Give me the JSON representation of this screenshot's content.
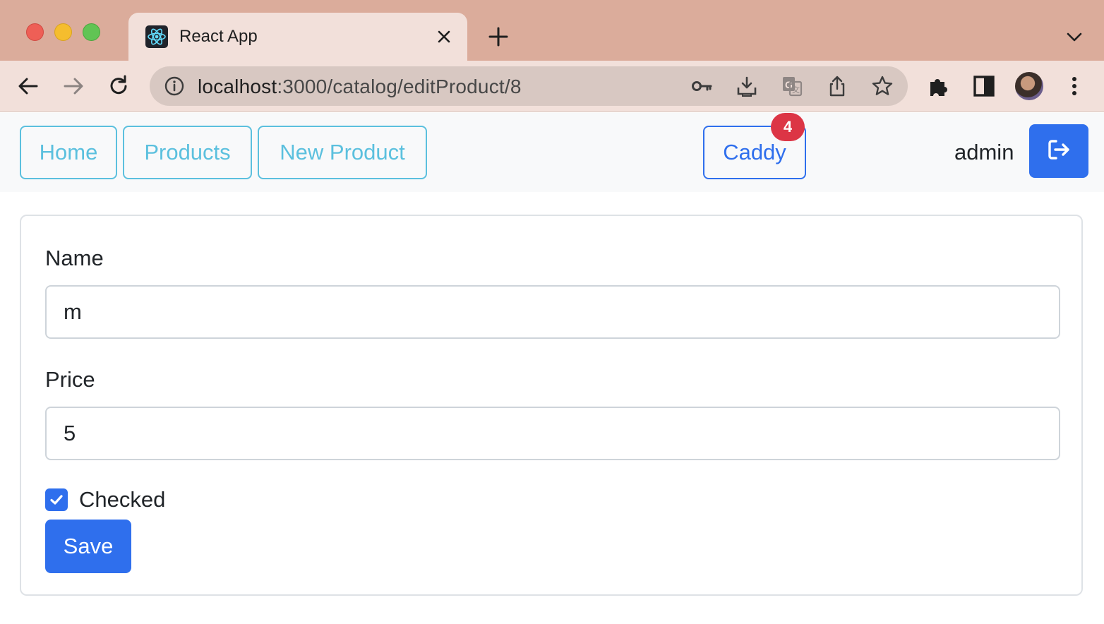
{
  "browser": {
    "tab_title": "React App",
    "url_host": "localhost",
    "url_path": ":3000/catalog/editProduct/8",
    "icons": [
      "react-favicon-icon",
      "close-icon",
      "plus-icon",
      "chevron-down-icon",
      "back-arrow-icon",
      "forward-arrow-icon",
      "reload-icon",
      "info-icon",
      "key-icon",
      "install-icon",
      "translate-icon",
      "share-icon",
      "star-icon",
      "puzzle-icon",
      "side-panel-icon",
      "more-vert-icon"
    ]
  },
  "navbar": {
    "home_label": "Home",
    "products_label": "Products",
    "new_product_label": "New Product",
    "caddy_label": "Caddy",
    "caddy_count": "4",
    "username": "admin",
    "logout_icon": "sign-out-icon"
  },
  "form": {
    "name_label": "Name",
    "name_value": "m",
    "price_label": "Price",
    "price_value": "5",
    "checked_label": "Checked",
    "checked": true,
    "save_label": "Save"
  },
  "colors": {
    "primary": "#2f6fed",
    "info": "#5bc0de",
    "danger": "#dc3545",
    "tabbar": "#dbac9b",
    "toolbar": "#f2e0da"
  }
}
